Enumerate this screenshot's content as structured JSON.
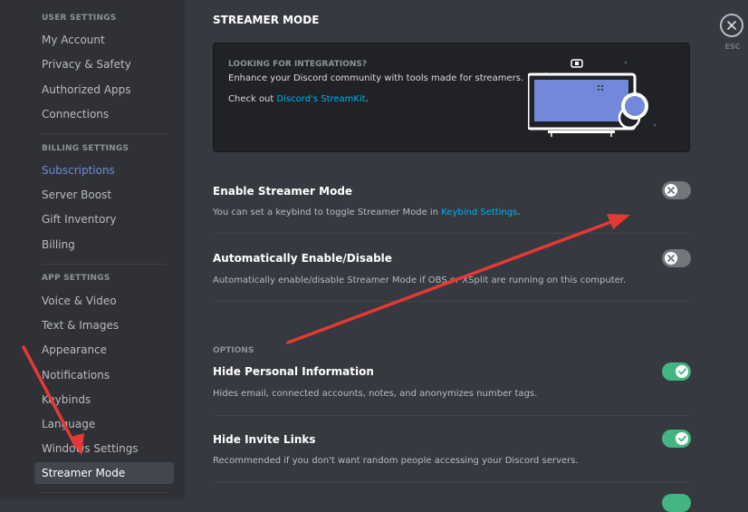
{
  "sidebar": {
    "user_header": "USER SETTINGS",
    "user_items": [
      "My Account",
      "Privacy & Safety",
      "Authorized Apps",
      "Connections"
    ],
    "billing_header": "BILLING SETTINGS",
    "billing_items": [
      "Subscriptions",
      "Server Boost",
      "Gift Inventory",
      "Billing"
    ],
    "app_header": "APP SETTINGS",
    "app_items": [
      "Voice & Video",
      "Text & Images",
      "Appearance",
      "Notifications",
      "Keybinds",
      "Language",
      "Windows Settings",
      "Streamer Mode"
    ]
  },
  "main": {
    "title": "STREAMER MODE",
    "promo": {
      "heading": "LOOKING FOR INTEGRATIONS?",
      "description": "Enhance your Discord community with tools made for streamers.",
      "link_prefix": "Check out ",
      "link_text": "Discord's StreamKit",
      "link_suffix": "."
    },
    "settings": [
      {
        "title": "Enable Streamer Mode",
        "desc_prefix": "You can set a keybind to toggle Streamer Mode in ",
        "desc_link": "Keybind Settings",
        "desc_suffix": ".",
        "enabled": false
      },
      {
        "title": "Automatically Enable/Disable",
        "desc": "Automatically enable/disable Streamer Mode if OBS or XSplit are running on this computer.",
        "enabled": false
      }
    ],
    "options_label": "OPTIONS",
    "options": [
      {
        "title": "Hide Personal Information",
        "desc": "Hides email, connected accounts, notes, and anonymizes number tags.",
        "enabled": true
      },
      {
        "title": "Hide Invite Links",
        "desc": "Recommended if you don't want random people accessing your Discord servers.",
        "enabled": true
      }
    ]
  },
  "close": {
    "label": "ESC"
  },
  "colors": {
    "toggle_on": "#43b581",
    "toggle_off": "#72767d",
    "link": "#00b0f4",
    "accent": "#7289da",
    "annotation_arrow": "#e53935"
  }
}
